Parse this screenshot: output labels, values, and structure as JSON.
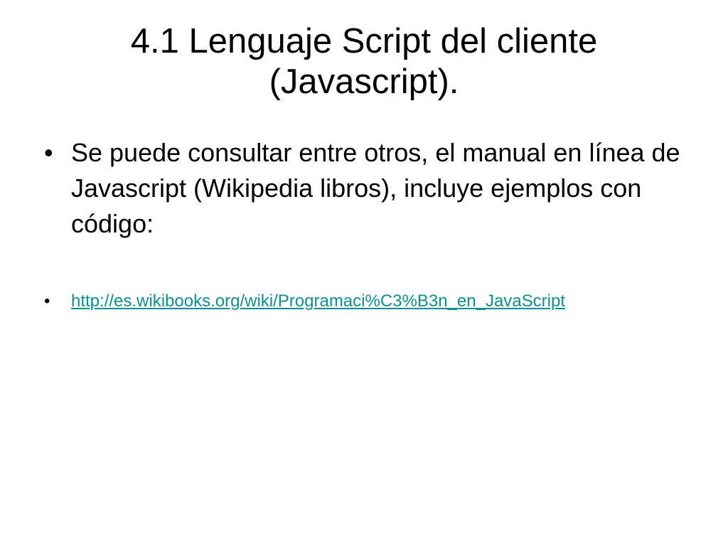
{
  "slide": {
    "title_line1": "4.1 Lenguaje Script del cliente",
    "title_line2": "(Javascript).",
    "bullets": [
      {
        "marker": "•",
        "text": "Se puede consultar entre otros, el manual en línea de Javascript (Wikipedia libros), incluye ejemplos con código:"
      },
      {
        "marker": "•",
        "link_text": "http://es.wikibooks.org/wiki/Programaci%C3%B3n_en_JavaScript"
      }
    ],
    "colors": {
      "background": "#ffffff",
      "text": "#000000",
      "link": "#0f8f8f"
    }
  }
}
